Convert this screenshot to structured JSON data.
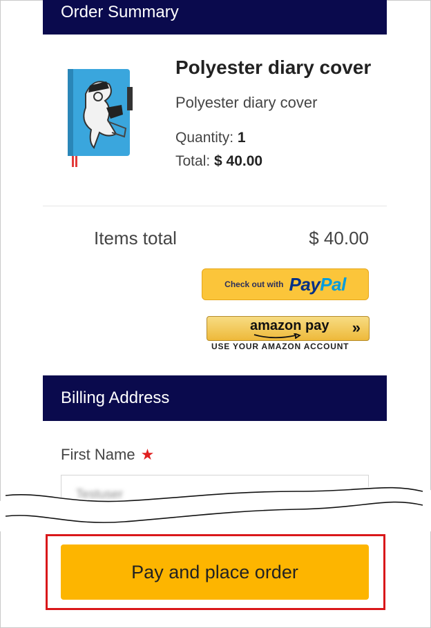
{
  "order_summary": {
    "heading": "Order Summary",
    "product": {
      "title": "Polyester diary cover",
      "subtitle": "Polyester diary cover",
      "quantity_label": "Quantity:",
      "quantity_value": "1",
      "total_label": "Total:",
      "total_value": "$ 40.00"
    },
    "items_total_label": "Items total",
    "items_total_value": "$ 40.00"
  },
  "payment": {
    "paypal_caption": "Check out with",
    "paypal_logo_dark": "Pay",
    "paypal_logo_light": "Pal",
    "amazon_label": "amazon pay",
    "amazon_chevron": "»",
    "amazon_sub": "USE YOUR AMAZON ACCOUNT"
  },
  "billing": {
    "heading": "Billing Address",
    "first_name_label": "First Name",
    "required_mark": "★",
    "first_name_value": "Testuser"
  },
  "actions": {
    "place_order_label": "Pay and place order"
  },
  "colors": {
    "section_bar": "#0a0a4d",
    "place_order": "#fdb500",
    "highlight": "#d9171a",
    "paypal_bg": "#fbc53a"
  }
}
